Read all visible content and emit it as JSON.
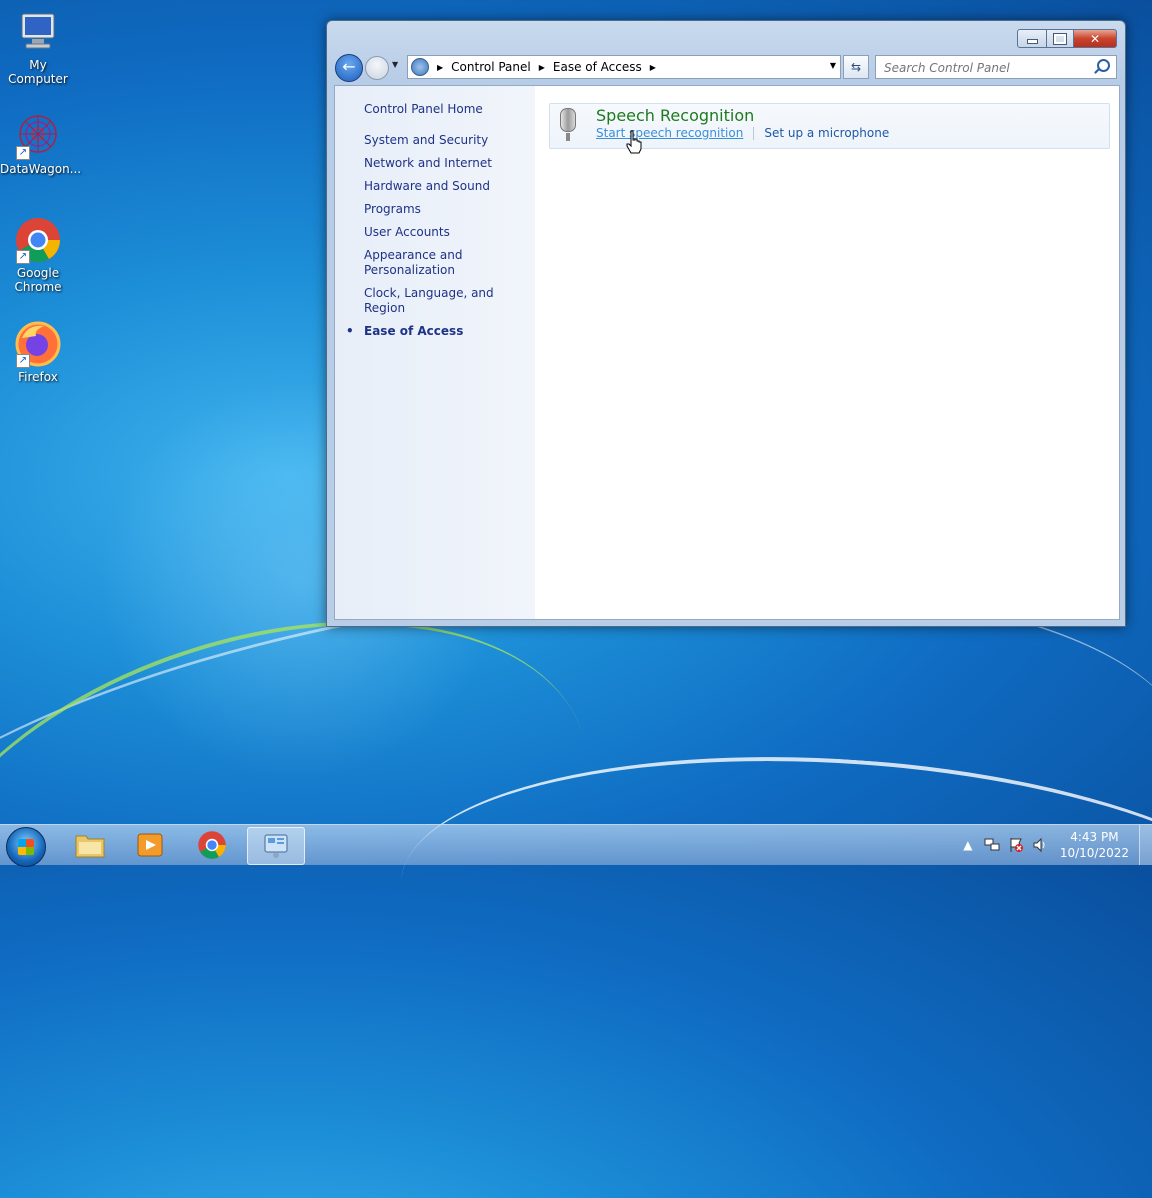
{
  "desktop": {
    "icons": [
      {
        "label": "My Computer"
      },
      {
        "label": "DataWagon..."
      },
      {
        "label": "Google Chrome"
      },
      {
        "label": "Firefox"
      }
    ]
  },
  "window": {
    "breadcrumb": [
      "Control Panel",
      "Ease of Access"
    ],
    "search_placeholder": "Search Control Panel",
    "left_nav": {
      "home": "Control Panel Home",
      "items": [
        "System and Security",
        "Network and Internet",
        "Hardware and Sound",
        "Programs",
        "User Accounts",
        "Appearance and Personalization",
        "Clock, Language, and Region",
        "Ease of Access"
      ],
      "current": "Ease of Access"
    },
    "category": {
      "title": "Speech Recognition",
      "links": [
        "Start speech recognition",
        "Set up a microphone"
      ]
    }
  },
  "taskbar": {
    "clock_time": "4:43 PM",
    "clock_date": "10/10/2022"
  },
  "colors": {
    "category_title": "#1e7a1e",
    "link": "#1e58a8",
    "nav_link": "#1e3287"
  }
}
